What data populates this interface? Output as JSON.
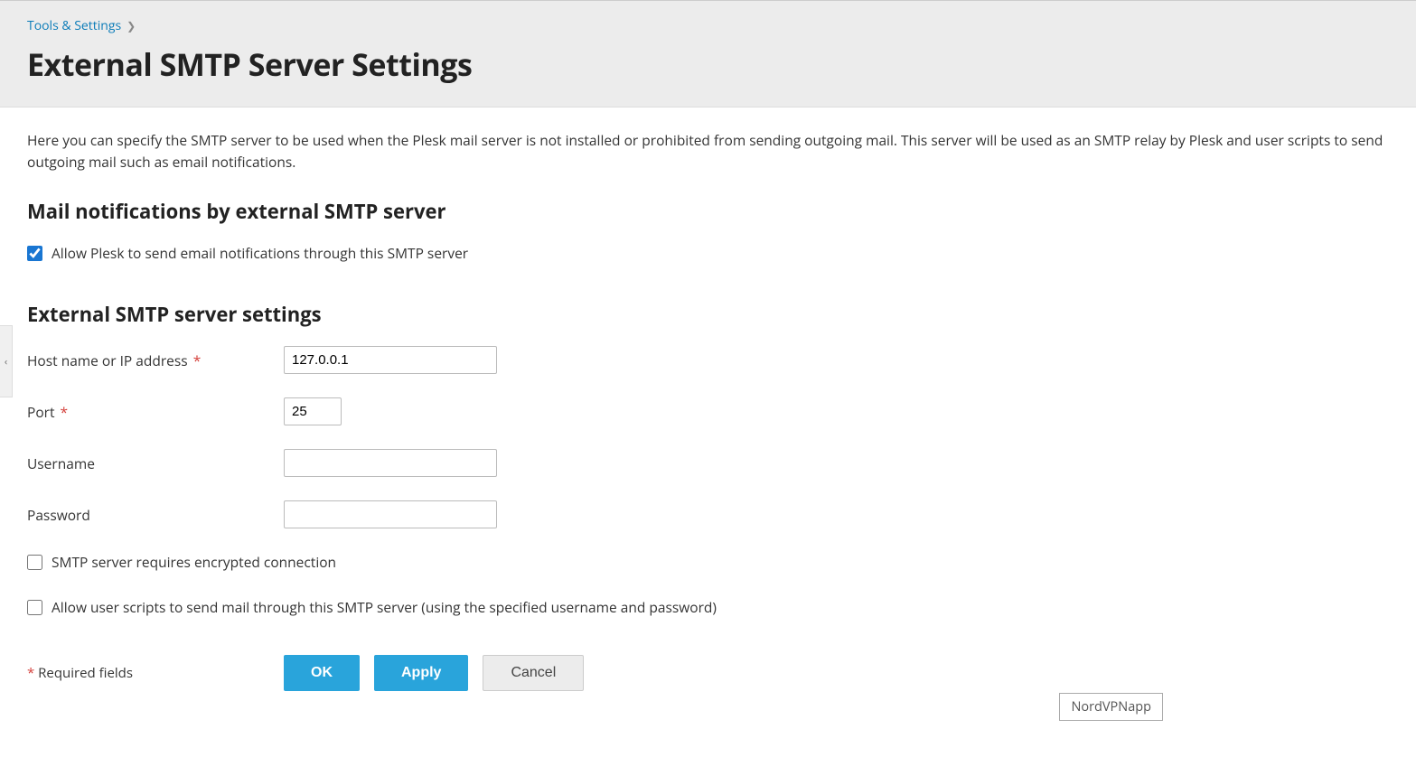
{
  "breadcrumb": {
    "parent": "Tools & Settings"
  },
  "page_title": "External SMTP Server Settings",
  "description": "Here you can specify the SMTP server to be used when the Plesk mail server is not installed or prohibited from sending outgoing mail. This server will be used as an SMTP relay by Plesk and user scripts to send outgoing mail such as email notifications.",
  "sections": {
    "notifications": {
      "title": "Mail notifications by external SMTP server",
      "allow_label": "Allow Plesk to send email notifications through this SMTP server"
    },
    "smtp": {
      "title": "External SMTP server settings",
      "fields": {
        "host": {
          "label": "Host name or IP address",
          "required": "*",
          "value": "127.0.0.1"
        },
        "port": {
          "label": "Port",
          "required": "*",
          "value": "25"
        },
        "username": {
          "label": "Username",
          "value": ""
        },
        "password": {
          "label": "Password",
          "value": ""
        }
      },
      "checkboxes": {
        "encrypted": "SMTP server requires encrypted connection",
        "user_scripts": "Allow user scripts to send mail through this SMTP server (using the specified username and password)"
      }
    }
  },
  "footer": {
    "required_note_star": "*",
    "required_note": " Required fields",
    "buttons": {
      "ok": "OK",
      "apply": "Apply",
      "cancel": "Cancel"
    }
  },
  "floating_badge": "NordVPNapp"
}
